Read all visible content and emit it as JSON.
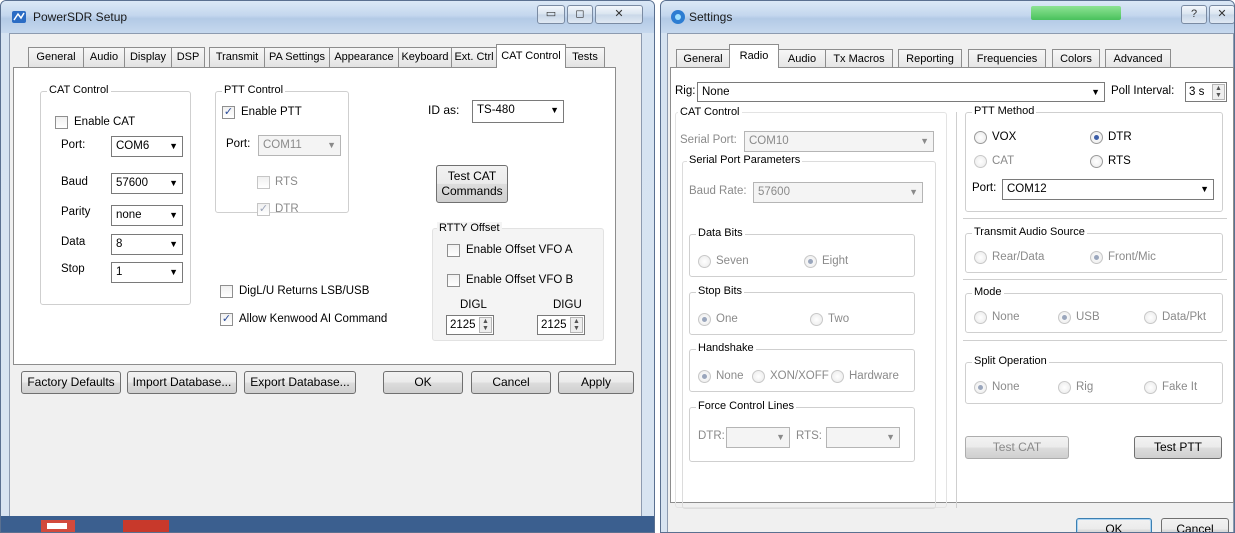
{
  "powersdr": {
    "title": "PowerSDR Setup",
    "tabs": [
      "General",
      "Audio",
      "Display",
      "DSP",
      "Transmit",
      "PA Settings",
      "Appearance",
      "Keyboard",
      "Ext. Ctrl",
      "CAT Control",
      "Tests"
    ],
    "cat_control": {
      "label": "CAT Control",
      "enable_label": "Enable CAT",
      "port_label": "Port:",
      "port_value": "COM6",
      "baud_label": "Baud",
      "baud_value": "57600",
      "parity_label": "Parity",
      "parity_value": "none",
      "data_label": "Data",
      "data_value": "8",
      "stop_label": "Stop",
      "stop_value": "1"
    },
    "ptt_control": {
      "label": "PTT Control",
      "enable_label": "Enable PTT",
      "port_label": "Port:",
      "port_value": "COM11",
      "rts_label": "RTS",
      "dtr_label": "DTR"
    },
    "digl_label": "DigL/U Returns LSB/USB",
    "kenwood_label": "Allow Kenwood AI Command",
    "id_as_label": "ID as:",
    "id_as_value": "TS-480",
    "test_cat_line1": "Test CAT",
    "test_cat_line2": "Commands",
    "rtty": {
      "label": "RTTY Offset",
      "vfo_a": "Enable Offset VFO A",
      "vfo_b": "Enable Offset VFO B",
      "digl": "DIGL",
      "digu": "DIGU",
      "digl_value": "2125",
      "digu_value": "2125"
    },
    "buttons": {
      "factory": "Factory Defaults",
      "import": "Import Database...",
      "export": "Export Database...",
      "ok": "OK",
      "cancel": "Cancel",
      "apply": "Apply"
    }
  },
  "settings": {
    "title": "Settings",
    "help_glyph": "?",
    "close_glyph": "✕",
    "tabs": [
      "General",
      "Radio",
      "Audio",
      "Tx Macros",
      "Reporting",
      "Frequencies",
      "Colors",
      "Advanced"
    ],
    "rig_label": "Rig:",
    "rig_value": "None",
    "poll_label": "Poll Interval:",
    "poll_value": "3 s",
    "cat": {
      "label": "CAT Control",
      "serial_port_label": "Serial Port:",
      "serial_port_value": "COM10",
      "params_label": "Serial Port Parameters",
      "baud_label": "Baud Rate:",
      "baud_value": "57600",
      "data_bits_label": "Data Bits",
      "seven": "Seven",
      "eight": "Eight",
      "stop_bits_label": "Stop Bits",
      "one": "One",
      "two": "Two",
      "handshake_label": "Handshake",
      "hs_none": "None",
      "hs_xon": "XON/XOFF",
      "hs_hw": "Hardware",
      "force_label": "Force Control Lines",
      "dtr_label": "DTR:",
      "rts_label": "RTS:"
    },
    "ptt": {
      "label": "PTT Method",
      "vox": "VOX",
      "dtr": "DTR",
      "cat": "CAT",
      "rts": "RTS",
      "port_label": "Port:",
      "port_value": "COM12"
    },
    "tx_audio": {
      "label": "Transmit Audio Source",
      "rear": "Rear/Data",
      "front": "Front/Mic"
    },
    "mode": {
      "label": "Mode",
      "none": "None",
      "usb": "USB",
      "data": "Data/Pkt"
    },
    "split": {
      "label": "Split Operation",
      "none": "None",
      "rig": "Rig",
      "fake": "Fake It"
    },
    "test_cat": "Test CAT",
    "test_ptt": "Test PTT",
    "ok": "OK",
    "cancel": "Cancel"
  }
}
